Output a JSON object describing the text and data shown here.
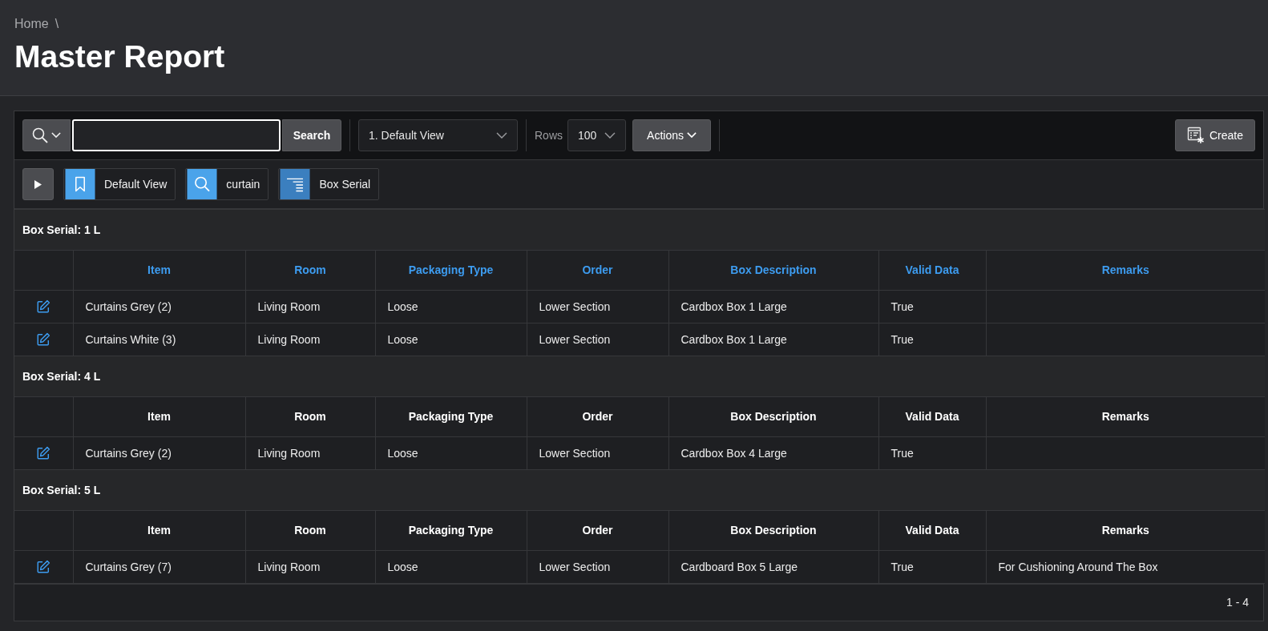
{
  "breadcrumb": {
    "items": [
      "Home"
    ],
    "separator": "\\"
  },
  "page_title": "Master Report",
  "toolbar": {
    "search_field": {
      "focused": true
    },
    "search_button": "Search",
    "view_select": "1. Default View",
    "rows_label": "Rows",
    "rows_select": "100",
    "actions_button": "Actions",
    "create_button": "Create"
  },
  "filters": [
    {
      "kind": "view",
      "label": "Default View"
    },
    {
      "kind": "search",
      "label": "curtain"
    },
    {
      "kind": "break",
      "label": "Box Serial"
    }
  ],
  "report": {
    "groups": [
      {
        "label": "Box Serial: 1 L",
        "header_links": true,
        "columns": [
          "Item",
          "Room",
          "Packaging Type",
          "Order",
          "Box Description",
          "Valid Data",
          "Remarks"
        ],
        "rows": [
          {
            "item": "Curtains Grey (2)",
            "room": "Living Room",
            "packaging_type": "Loose",
            "order": "Lower Section",
            "box_description": "Cardbox Box 1 Large",
            "valid_data": "True"
          },
          {
            "item": "Curtains White (3)",
            "room": "Living Room",
            "packaging_type": "Loose",
            "order": "Lower Section",
            "box_description": "Cardbox Box 1 Large",
            "valid_data": "True"
          }
        ]
      },
      {
        "label": "Box Serial: 4 L",
        "header_links": false,
        "columns": [
          "Item",
          "Room",
          "Packaging Type",
          "Order",
          "Box Description",
          "Valid Data",
          "Remarks"
        ],
        "rows": [
          {
            "item": "Curtains Grey (2)",
            "room": "Living Room",
            "packaging_type": "Loose",
            "order": "Lower Section",
            "box_description": "Cardbox Box 4 Large",
            "valid_data": "True"
          }
        ]
      },
      {
        "label": "Box Serial: 5 L",
        "header_links": false,
        "columns": [
          "Item",
          "Room",
          "Packaging Type",
          "Order",
          "Box Description",
          "Valid Data",
          "Remarks"
        ],
        "rows": [
          {
            "item": "Curtains Grey (7)",
            "room": "Living Room",
            "packaging_type": "Loose",
            "order": "Lower Section",
            "box_description": "Cardboard Box 5 Large",
            "valid_data": "True",
            "remarks": "For Cushioning Around The Box"
          }
        ]
      }
    ],
    "pagination": "1 - 4"
  }
}
